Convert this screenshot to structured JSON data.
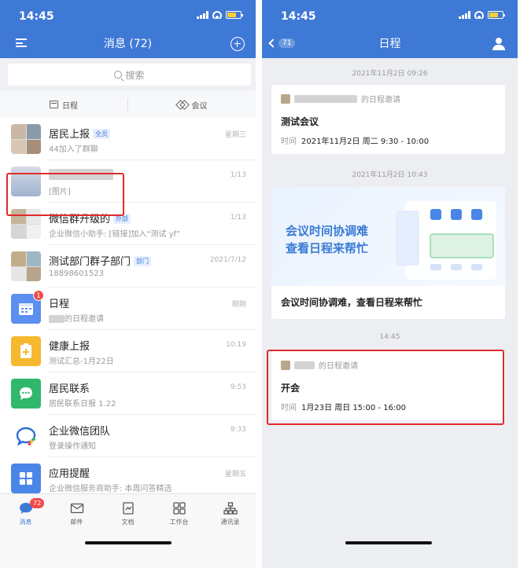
{
  "left": {
    "status": {
      "time": "14:45"
    },
    "nav": {
      "title": "消息 (72)"
    },
    "search": {
      "placeholder": "搜索"
    },
    "quick": {
      "schedule": "日程",
      "meeting": "会议"
    },
    "chats": [
      {
        "name": "居民上报",
        "tag": "全员",
        "preview": "44加入了群聊",
        "time": "星期三"
      },
      {
        "name": "",
        "tag": "",
        "preview": "[图片]",
        "time": "1/13"
      },
      {
        "name": "微信群升级的",
        "tag": "外部",
        "preview": "企业微信小助手: [链接]加入“测试 yf”",
        "time": "1/13"
      },
      {
        "name": "测试部门群子部门",
        "tag": "部门",
        "preview": "18898601523",
        "time": "2021/7/12"
      },
      {
        "name": "日程",
        "tag": "",
        "preview": "的日程邀请",
        "time": "刚刚",
        "badge": "1"
      },
      {
        "name": "健康上报",
        "tag": "",
        "preview": "测试汇总-1月22日",
        "time": "10:19"
      },
      {
        "name": "居民联系",
        "tag": "",
        "preview": "居民联系日报 1.22",
        "time": "9:53"
      },
      {
        "name": "企业微信团队",
        "tag": "",
        "preview": "登录操作通知",
        "time": "9:33"
      },
      {
        "name": "应用提醒",
        "tag": "",
        "preview": "企业微信服务商助手: 本周问答精选",
        "time": "星期五"
      }
    ],
    "tabs": [
      {
        "label": "消息",
        "badge": "72"
      },
      {
        "label": "邮件"
      },
      {
        "label": "文档"
      },
      {
        "label": "工作台"
      },
      {
        "label": "通讯录"
      }
    ]
  },
  "right": {
    "status": {
      "time": "14:45"
    },
    "nav": {
      "title": "日程",
      "back_count": "71"
    },
    "ts1": "2021年11月2日 09:26",
    "card1": {
      "head": "的日程邀请",
      "title": "测试会议",
      "time_label": "时间",
      "time_value": "2021年11月2日 周二 9:30 - 10:00"
    },
    "ts2": "2021年11月2日 10:43",
    "banner": {
      "line1": "会议时间协调难",
      "line2": "查看日程来帮忙",
      "caption": "会议时间协调难，查看日程来帮忙"
    },
    "ts3": "14:45",
    "card2": {
      "head": "的日程邀请",
      "title": "开会",
      "time_label": "时间",
      "time_value": "1月23日 周日 15:00 - 16:00"
    }
  },
  "colors": {
    "brand": "#3f79d6",
    "highlight": "#e02a2a",
    "badge": "#f04b4b"
  }
}
